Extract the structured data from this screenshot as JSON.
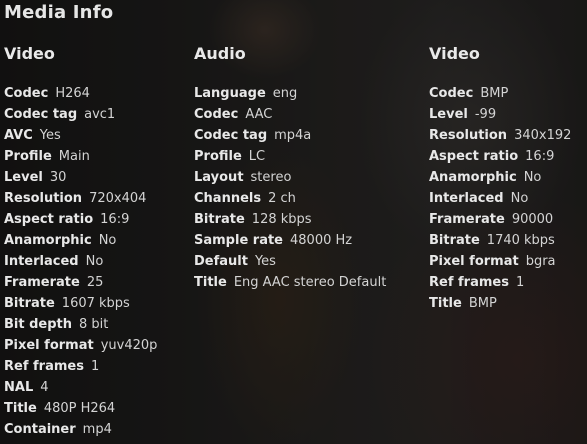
{
  "title": "Media Info",
  "columns": [
    {
      "heading": "Video",
      "rows": [
        {
          "key": "Codec",
          "value": "H264"
        },
        {
          "key": "Codec tag",
          "value": "avc1"
        },
        {
          "key": "AVC",
          "value": "Yes"
        },
        {
          "key": "Profile",
          "value": "Main"
        },
        {
          "key": "Level",
          "value": "30"
        },
        {
          "key": "Resolution",
          "value": "720x404"
        },
        {
          "key": "Aspect ratio",
          "value": "16:9"
        },
        {
          "key": "Anamorphic",
          "value": "No"
        },
        {
          "key": "Interlaced",
          "value": "No"
        },
        {
          "key": "Framerate",
          "value": "25"
        },
        {
          "key": "Bitrate",
          "value": "1607 kbps"
        },
        {
          "key": "Bit depth",
          "value": "8 bit"
        },
        {
          "key": "Pixel format",
          "value": "yuv420p"
        },
        {
          "key": "Ref frames",
          "value": "1"
        },
        {
          "key": "NAL",
          "value": "4"
        },
        {
          "key": "Title",
          "value": "480P H264"
        },
        {
          "key": "Container",
          "value": "mp4"
        }
      ]
    },
    {
      "heading": "Audio",
      "rows": [
        {
          "key": "Language",
          "value": "eng"
        },
        {
          "key": "Codec",
          "value": "AAC"
        },
        {
          "key": "Codec tag",
          "value": "mp4a"
        },
        {
          "key": "Profile",
          "value": "LC"
        },
        {
          "key": "Layout",
          "value": "stereo"
        },
        {
          "key": "Channels",
          "value": "2 ch"
        },
        {
          "key": "Bitrate",
          "value": "128 kbps"
        },
        {
          "key": "Sample rate",
          "value": "48000 Hz"
        },
        {
          "key": "Default",
          "value": "Yes"
        },
        {
          "key": "Title",
          "value": "Eng AAC stereo Default"
        }
      ]
    },
    {
      "heading": "Video",
      "rows": [
        {
          "key": "Codec",
          "value": "BMP"
        },
        {
          "key": "Level",
          "value": "-99"
        },
        {
          "key": "Resolution",
          "value": "340x192"
        },
        {
          "key": "Aspect ratio",
          "value": "16:9"
        },
        {
          "key": "Anamorphic",
          "value": "No"
        },
        {
          "key": "Interlaced",
          "value": "No"
        },
        {
          "key": "Framerate",
          "value": "90000"
        },
        {
          "key": "Bitrate",
          "value": "1740 kbps"
        },
        {
          "key": "Pixel format",
          "value": "bgra"
        },
        {
          "key": "Ref frames",
          "value": "1"
        },
        {
          "key": "Title",
          "value": "BMP"
        }
      ]
    }
  ]
}
